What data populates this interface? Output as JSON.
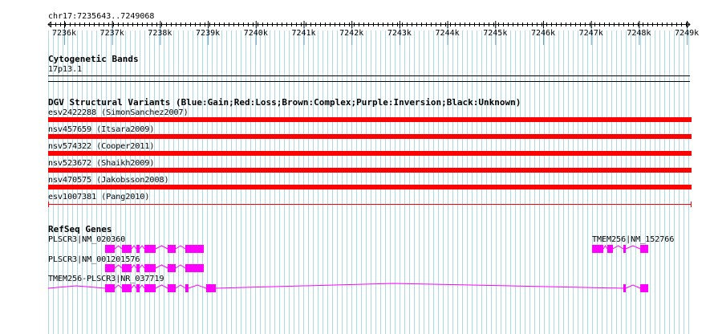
{
  "location": "chr17:7235643..7249068",
  "ruler": {
    "ticks": [
      "7236k",
      "7237k",
      "7238k",
      "7239k",
      "7240k",
      "7241k",
      "7242k",
      "7243k",
      "7244k",
      "7245k",
      "7246k",
      "7247k",
      "7248k",
      "7249k"
    ]
  },
  "tracks": {
    "cytoband": {
      "title": "Cytogenetic Bands",
      "band": "17p13.1"
    },
    "dgv": {
      "title": "DGV Structural Variants (Blue:Gain;Red:Loss;Brown:Complex;Purple:Inversion;Black:Unknown)",
      "variants": [
        {
          "label": "esv2422288 (SimonSanchez2007)",
          "style": "bar"
        },
        {
          "label": "nsv457659 (Itsara2009)",
          "style": "bar"
        },
        {
          "label": "nsv574322 (Cooper2011)",
          "style": "bar"
        },
        {
          "label": "nsv523672 (Shaikh2009)",
          "style": "bar"
        },
        {
          "label": "nsv470575 (Jakobsson2008)",
          "style": "bar"
        },
        {
          "label": "esv1007381 (Pang2010)",
          "style": "line"
        }
      ],
      "color": "#ff0000"
    },
    "refseq": {
      "title": "RefSeq Genes",
      "genes": [
        {
          "label": "PLSCR3|NM_020360"
        },
        {
          "label": "PLSCR3|NM_001201576"
        },
        {
          "label": "TMEM256-PLSCR3|NR_037719"
        },
        {
          "label": "TMEM256|NM_152766"
        }
      ],
      "color": "#ff00ff"
    }
  },
  "colors": {
    "grid_minor": "#add8e6",
    "grid_major": "#6ba3c3",
    "variant": "#ff0000",
    "gene": "#ff00ff"
  }
}
